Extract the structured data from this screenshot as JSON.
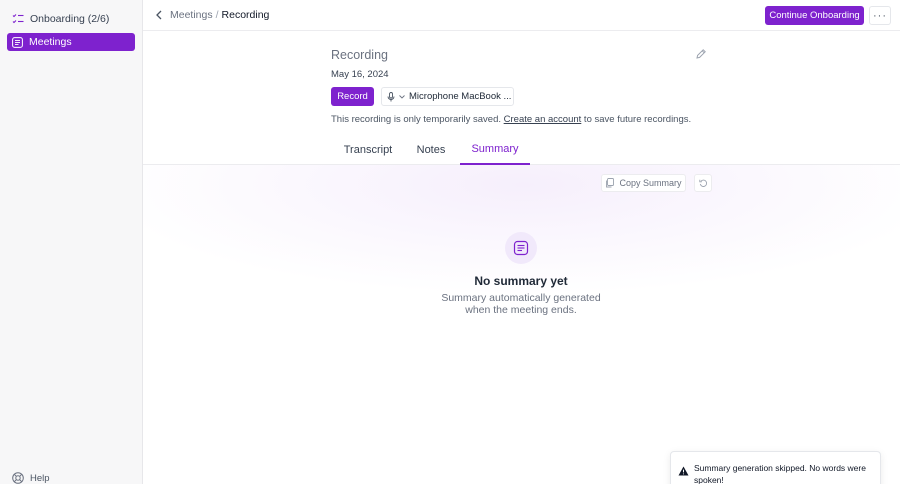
{
  "sidebar": {
    "onboarding_label": "Onboarding (2/6)",
    "meetings_label": "Meetings",
    "help_label": "Help"
  },
  "header": {
    "breadcrumb_parent": "Meetings",
    "breadcrumb_sep": "/",
    "breadcrumb_current": "Recording",
    "continue_label": "Continue Onboarding",
    "more_label": "···"
  },
  "recording": {
    "title": "Recording",
    "date": "May 16, 2024",
    "record_label": "Record",
    "mic_value": "Microphone MacBook ...",
    "notice_before": "This recording is only temporarily saved. ",
    "notice_link": "Create an account",
    "notice_after": " to save future recordings."
  },
  "tabs": {
    "transcript": "Transcript",
    "notes": "Notes",
    "summary": "Summary"
  },
  "summary": {
    "copy_label": "Copy Summary",
    "empty_title": "No summary yet",
    "empty_line1": "Summary automatically generated",
    "empty_line2": "when the meeting ends."
  },
  "toast": {
    "message": "Summary generation skipped. No words were spoken!"
  },
  "colors": {
    "accent": "#7e22ce",
    "accent_soft": "#f1e9fb"
  }
}
